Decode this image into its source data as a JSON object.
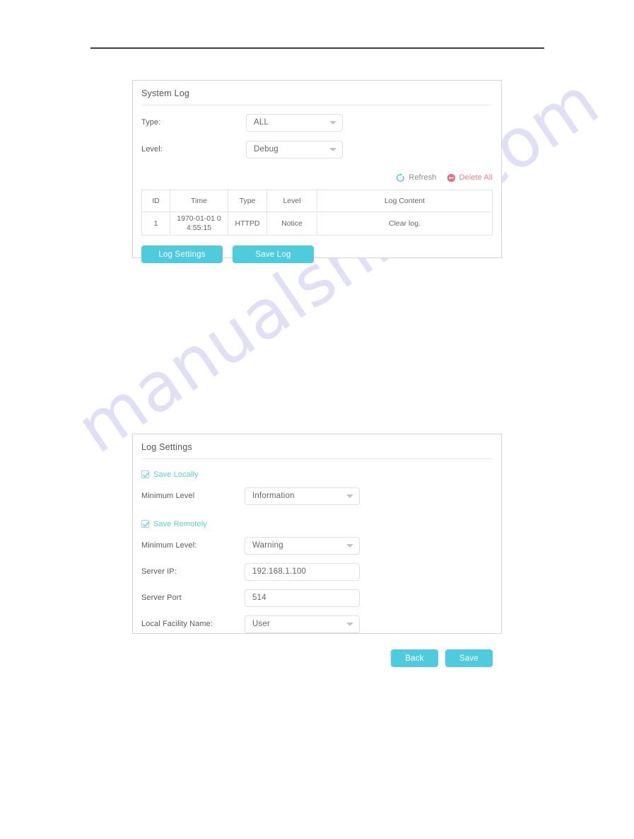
{
  "watermark": {
    "text": "manualshive.com",
    "color": "#c9c6ee"
  },
  "theme": {
    "accent": "#4ecbdc",
    "danger": "#f0808f",
    "link_grey": "#8e8e8e"
  },
  "system_log_panel": {
    "title": "System Log",
    "filters": [
      {
        "label": "Type:",
        "value": "ALL",
        "name": "type-select"
      },
      {
        "label": "Level:",
        "value": "Debug",
        "name": "level-select"
      }
    ],
    "actions": [
      {
        "label": "Refresh",
        "icon": "refresh-icon",
        "name": "refresh-link"
      },
      {
        "label": "Delete All",
        "icon": "minus-circle-icon",
        "name": "delete-all-link"
      }
    ],
    "table": {
      "columns": [
        "ID",
        "Time",
        "Type",
        "Level",
        "Log Content"
      ],
      "rows": [
        {
          "id": "1",
          "time_line1": "1970-01-01 0",
          "time_line2": "4:55:15",
          "type": "HTTPD",
          "level": "Notice",
          "content": "Clear log."
        }
      ]
    },
    "buttons": [
      {
        "label": "Log Settings",
        "name": "log-settings-button"
      },
      {
        "label": "Save Log",
        "name": "save-log-button"
      }
    ]
  },
  "log_settings_panel": {
    "title": "Log Settings",
    "save_locally": {
      "label": "Save Locally",
      "checked": true,
      "minimum_level_label": "Minimum Level",
      "minimum_level_value": "Information"
    },
    "save_remotely": {
      "label": "Save Remotely",
      "checked": true,
      "minimum_level_label": "Minimum Level:",
      "minimum_level_value": "Warning",
      "server_ip_label": "Server IP:",
      "server_ip_value": "192.168.1.100",
      "server_port_label": "Server Port",
      "server_port_value": "514",
      "local_facility_label": "Local Facility Name:",
      "local_facility_value": "User"
    },
    "buttons": [
      {
        "label": "Back",
        "name": "back-button"
      },
      {
        "label": "Save",
        "name": "save-button"
      }
    ]
  }
}
